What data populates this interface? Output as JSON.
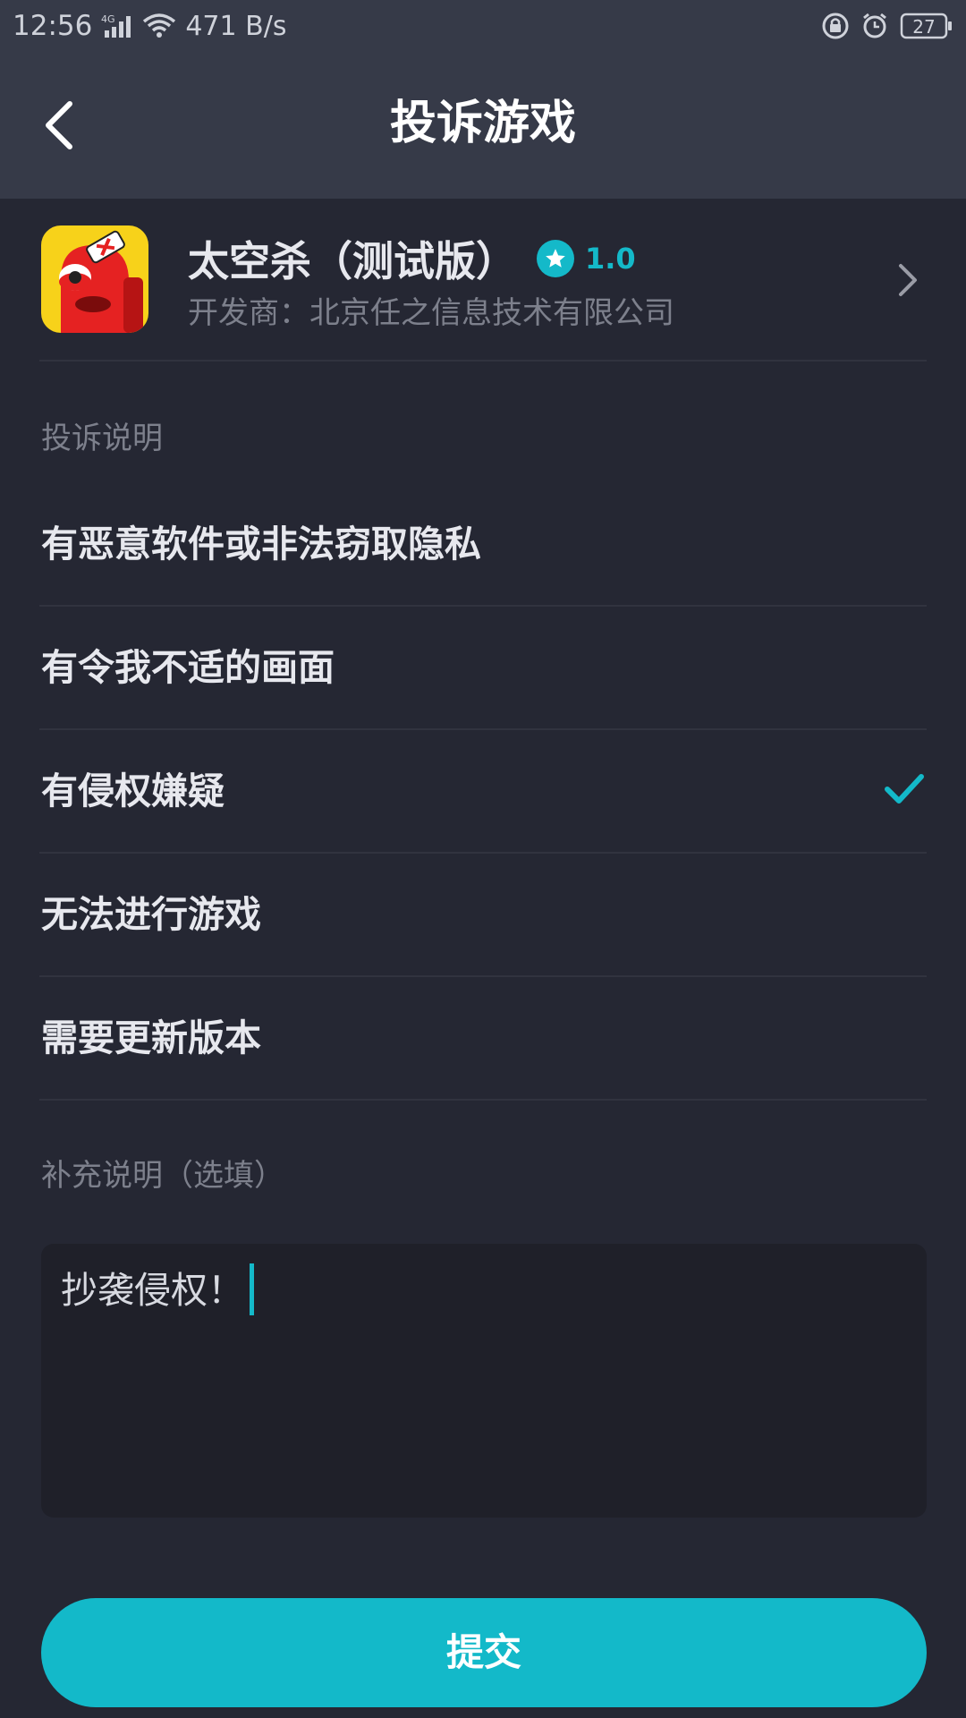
{
  "status_bar": {
    "time": "12:56",
    "network": "4G",
    "speed": "471 B/s",
    "battery": "27"
  },
  "header": {
    "title": "投诉游戏",
    "back_icon": "chevron-left-icon"
  },
  "game": {
    "name": "太空杀（测试版）",
    "rating": "1.0",
    "developer": "开发商：北京任之信息技术有限公司",
    "icon": "game-logo-icon"
  },
  "complaint": {
    "section_label": "投诉说明",
    "options": [
      {
        "label": "有恶意软件或非法窃取隐私",
        "selected": false
      },
      {
        "label": "有令我不适的画面",
        "selected": false
      },
      {
        "label": "有侵权嫌疑",
        "selected": true
      },
      {
        "label": "无法进行游戏",
        "selected": false
      },
      {
        "label": "需要更新版本",
        "selected": false
      }
    ]
  },
  "supplement": {
    "label": "补充说明（选填）",
    "value": "抄袭侵权！"
  },
  "submit": {
    "label": "提交"
  },
  "colors": {
    "accent": "#13b9c9",
    "background": "#252733",
    "header": "#363a48",
    "input_bg": "#1f2029"
  }
}
